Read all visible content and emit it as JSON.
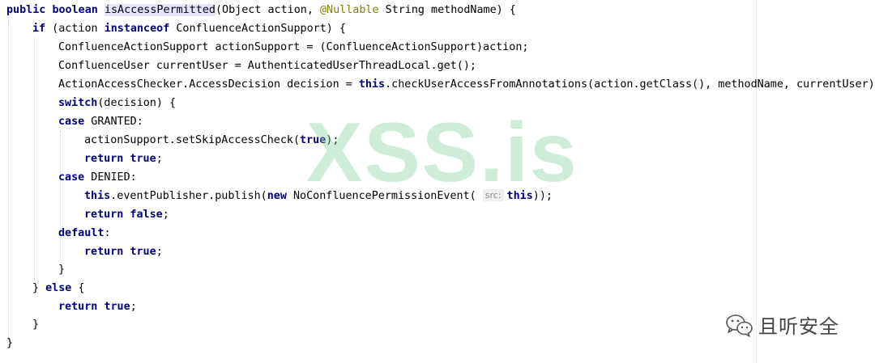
{
  "code": {
    "line1": {
      "kw1": "public",
      "kw2": "boolean",
      "method": "isAccessPermitted",
      "params_a": "(Object action, ",
      "annotation": "@Nullable",
      "params_b": " String methodName) {"
    },
    "line2": {
      "kw": "if",
      "mid": " (action ",
      "kw2": "instanceof",
      "rest": " ConfluenceActionSupport) {"
    },
    "line3": {
      "text": "ConfluenceActionSupport actionSupport = (ConfluenceActionSupport)action;"
    },
    "line4": {
      "text": "ConfluenceUser currentUser = AuthenticatedUserThreadLocal.get();"
    },
    "line5": {
      "pre": "ActionAccessChecker.AccessDecision decision = ",
      "kw": "this",
      "rest": ".checkUserAccessFromAnnotations(action.getClass(), methodName, currentUser);"
    },
    "line6": {
      "kw": "switch",
      "rest": "(decision) {"
    },
    "line7": {
      "kw": "case",
      "rest": " GRANTED:"
    },
    "line8": {
      "pre": "actionSupport.setSkipAccessCheck(",
      "kw": "true",
      "rest": ");"
    },
    "line9": {
      "kw": "return",
      "kw2": "true",
      "rest": ";"
    },
    "line10": {
      "kw": "case",
      "rest": " DENIED:"
    },
    "line11": {
      "kw": "this",
      "mid": ".eventPublisher.publish(",
      "kw2": "new",
      "mid2": " NoConfluencePermissionEvent( ",
      "hint": "src:",
      "kw3": "this",
      "rest": "));"
    },
    "line12": {
      "kw": "return",
      "kw2": "false",
      "rest": ";"
    },
    "line13": {
      "kw": "default",
      "rest": ":"
    },
    "line14": {
      "kw": "return",
      "kw2": "true",
      "rest": ";"
    },
    "line15": {
      "text": "}"
    },
    "line16": {
      "pre": "} ",
      "kw": "else",
      "rest": " {"
    },
    "line17": {
      "kw": "return",
      "kw2": "true",
      "rest": ";"
    },
    "line18": {
      "text": "}"
    },
    "line19": {
      "text": "}"
    }
  },
  "watermark": {
    "text": "XSS.is"
  },
  "brand": {
    "icon": "wechat-icon",
    "text": "且听安全"
  },
  "colors": {
    "keyword": "#000080",
    "annotation": "#808000",
    "highlight": "#e4e4ff",
    "watermark": "#7ecd96"
  }
}
